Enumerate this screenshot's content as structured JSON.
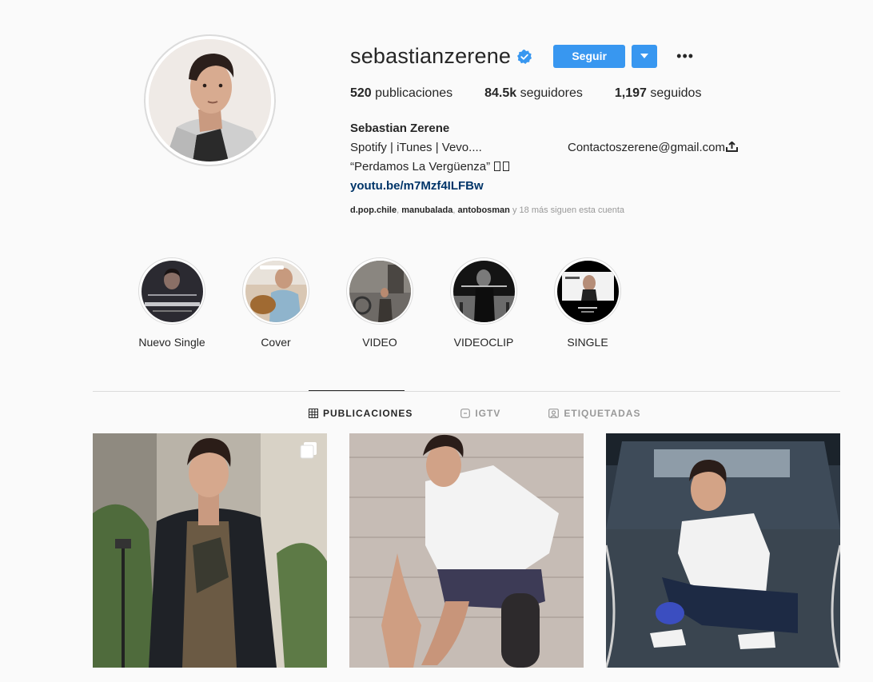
{
  "profile": {
    "username": "sebastianzerene",
    "verified": true,
    "follow_label": "Seguir",
    "more_label": "•••",
    "stats": {
      "posts_count": "520",
      "posts_label": "publicaciones",
      "followers_count": "84.5k",
      "followers_label": "seguidores",
      "following_count": "1,197",
      "following_label": "seguidos"
    },
    "full_name": "Sebastian Zerene",
    "bio_line1": "Spotify | iTunes | Vevo....",
    "bio_contact": "Contactoszerene@gmail.com",
    "bio_line2": "“Perdamos La Vergüenza” ",
    "bio_link": "youtu.be/m7Mzf4ILFBw",
    "followed_by": {
      "names": [
        "d.pop.chile",
        "manubalada",
        "antobosman"
      ],
      "suffix": "y 18 más siguen esta cuenta"
    }
  },
  "highlights": [
    {
      "label": "Nuevo Single"
    },
    {
      "label": "Cover"
    },
    {
      "label": "VIDEO"
    },
    {
      "label": "VIDEOCLIP"
    },
    {
      "label": "SINGLE"
    }
  ],
  "tabs": [
    {
      "label": "PUBLICACIONES",
      "icon": "grid-icon",
      "active": true
    },
    {
      "label": "IGTV",
      "icon": "igtv-icon",
      "active": false
    },
    {
      "label": "ETIQUETADAS",
      "icon": "tagged-icon",
      "active": false
    }
  ],
  "colors": {
    "accent": "#3897f0",
    "link": "#003569",
    "verified": "#3897f0",
    "muted": "#999999",
    "background": "#fafafa"
  }
}
